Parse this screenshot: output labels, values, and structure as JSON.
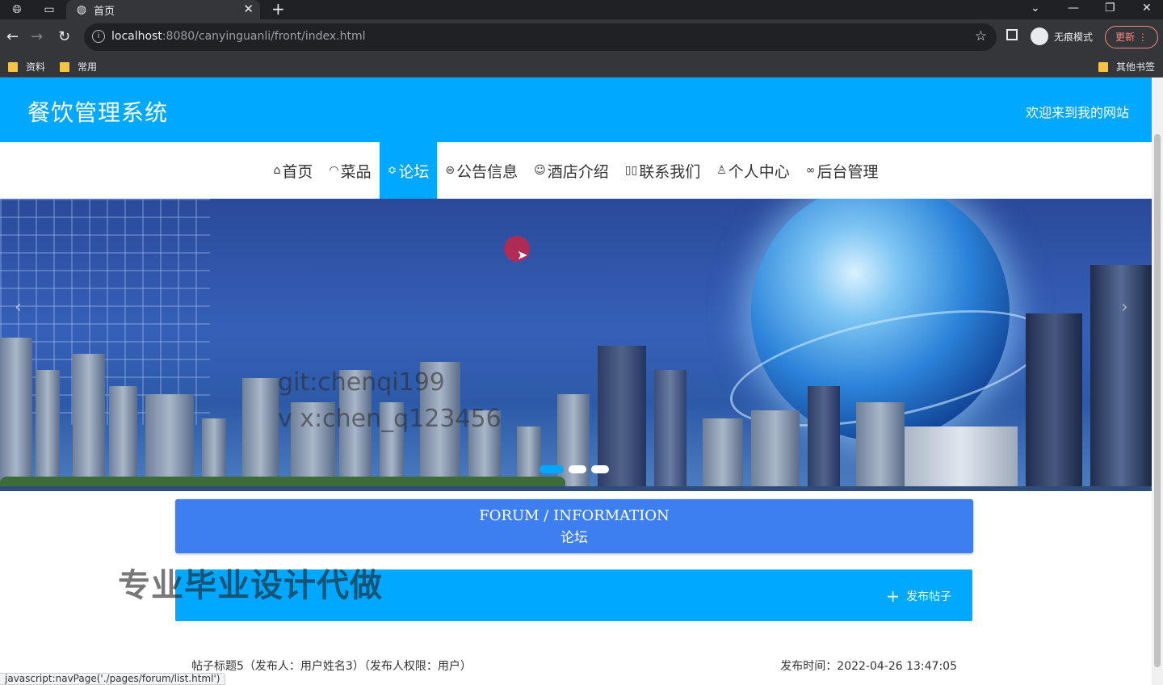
{
  "browser": {
    "tab_title": "首页",
    "url_host": "localhost",
    "url_rest": ":8080/canyinguanli/front/index.html",
    "incognito_label": "无痕模式",
    "update_label": "更新",
    "bookmarks": [
      "资料",
      "常用"
    ],
    "other_bookmarks": "其他书签",
    "status_url": "javascript:navPage('./pages/forum/list.html')"
  },
  "header": {
    "site_title": "餐饮管理系统",
    "welcome": "欢迎来到我的网站"
  },
  "nav": {
    "items": [
      {
        "label": "首页",
        "icon": "home-icon",
        "glyph": "⌂"
      },
      {
        "label": "菜品",
        "icon": "dashboard-icon",
        "glyph": "◠"
      },
      {
        "label": "论坛",
        "icon": "forum-icon",
        "glyph": "≎",
        "active": true
      },
      {
        "label": "公告信息",
        "icon": "notice-icon",
        "glyph": "⊜"
      },
      {
        "label": "酒店介绍",
        "icon": "hotel-icon",
        "glyph": "☺"
      },
      {
        "label": "联系我们",
        "icon": "contact-icon",
        "glyph": "▯▯"
      },
      {
        "label": "个人中心",
        "icon": "user-icon",
        "glyph": "♙"
      },
      {
        "label": "后台管理",
        "icon": "link-icon",
        "glyph": "∞"
      }
    ]
  },
  "banner": {
    "watermark_line1": "git:chenqi199",
    "watermark_line2": "v x:chen_q123456",
    "slides": 3,
    "active_slide": 0
  },
  "forum": {
    "title_en": "FORUM / INFORMATION",
    "title_cn": "论坛",
    "post_button": "发布帖子",
    "overlay_text": "专业毕业设计代做",
    "posts": [
      {
        "summary": "帖子标题5（发布人：用户姓名3）（发布人权限：用户）",
        "time": "发布时间：2022-04-26 13:47:05"
      }
    ]
  },
  "colors": {
    "primary": "#00a8ff",
    "forum_header": "#3d7ff0"
  }
}
